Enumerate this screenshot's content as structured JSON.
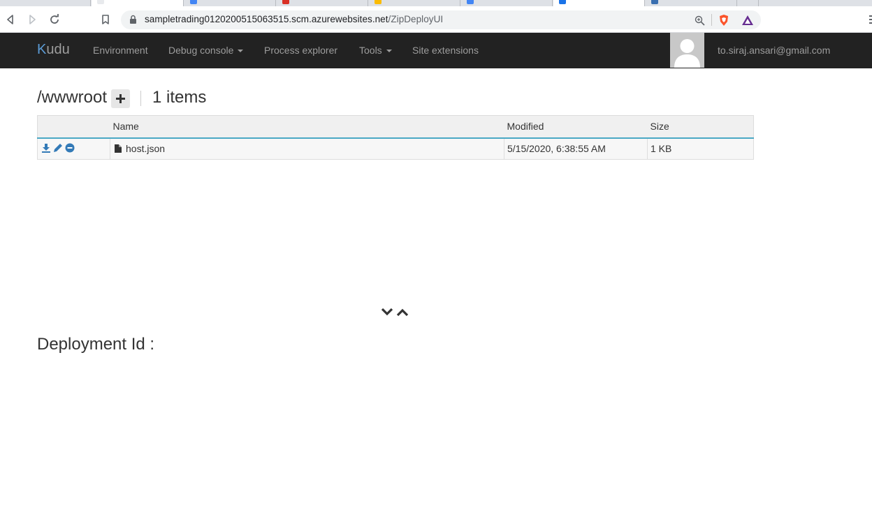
{
  "browser": {
    "url_host": "sampletrading0120200515063515.scm.azurewebsites.net",
    "url_path": "/ZipDeployUI",
    "tab_favicon_colors": [
      "#dadce0",
      "#e8eaed",
      "#4285f4",
      "#d93025",
      "#fbbc04",
      "#4285f4",
      "#1a73e8",
      "#3a6fb0",
      "#9aa0a6"
    ]
  },
  "navbar": {
    "brand": "udu",
    "brand_prefix": "K",
    "items": {
      "environment": "Environment",
      "debug_console": "Debug console",
      "process_explorer": "Process explorer",
      "tools": "Tools",
      "site_extensions": "Site extensions"
    },
    "user_email": "to.siraj.ansari@gmail.com"
  },
  "explorer": {
    "path": "/wwwroot",
    "items_count": "1 items",
    "columns": {
      "name": "Name",
      "modified": "Modified",
      "size": "Size"
    },
    "rows": [
      {
        "name": "host.json",
        "modified": "5/15/2020, 6:38:55 AM",
        "size": "1 KB"
      }
    ]
  },
  "deployment": {
    "label": "Deployment Id :"
  },
  "colors": {
    "navbar_bg": "#222222",
    "nav_text": "#9d9d9d",
    "accent": "#4aa8c4",
    "action_icon": "#337ab7"
  }
}
